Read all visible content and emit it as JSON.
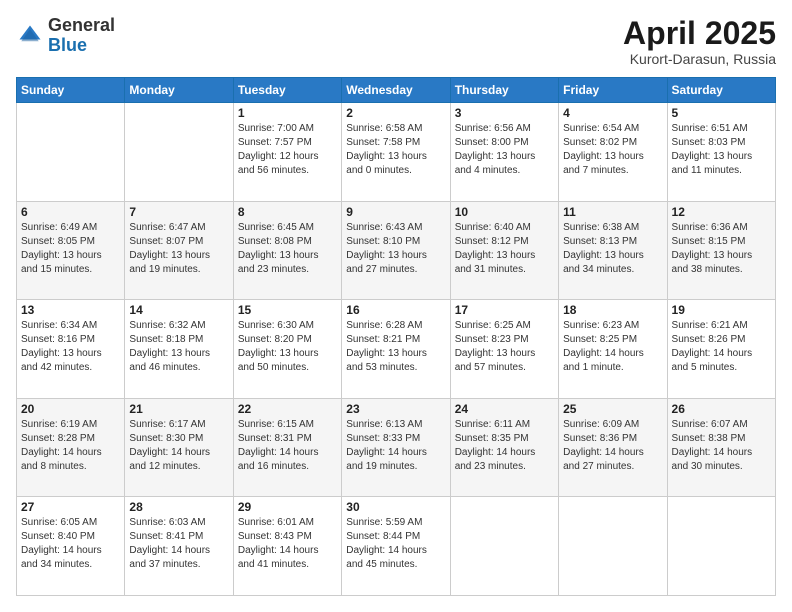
{
  "header": {
    "logo_general": "General",
    "logo_blue": "Blue",
    "month_title": "April 2025",
    "location": "Kurort-Darasun, Russia"
  },
  "weekdays": [
    "Sunday",
    "Monday",
    "Tuesday",
    "Wednesday",
    "Thursday",
    "Friday",
    "Saturday"
  ],
  "weeks": [
    [
      {
        "day": "",
        "info": ""
      },
      {
        "day": "",
        "info": ""
      },
      {
        "day": "1",
        "info": "Sunrise: 7:00 AM\nSunset: 7:57 PM\nDaylight: 12 hours\nand 56 minutes."
      },
      {
        "day": "2",
        "info": "Sunrise: 6:58 AM\nSunset: 7:58 PM\nDaylight: 13 hours\nand 0 minutes."
      },
      {
        "day": "3",
        "info": "Sunrise: 6:56 AM\nSunset: 8:00 PM\nDaylight: 13 hours\nand 4 minutes."
      },
      {
        "day": "4",
        "info": "Sunrise: 6:54 AM\nSunset: 8:02 PM\nDaylight: 13 hours\nand 7 minutes."
      },
      {
        "day": "5",
        "info": "Sunrise: 6:51 AM\nSunset: 8:03 PM\nDaylight: 13 hours\nand 11 minutes."
      }
    ],
    [
      {
        "day": "6",
        "info": "Sunrise: 6:49 AM\nSunset: 8:05 PM\nDaylight: 13 hours\nand 15 minutes."
      },
      {
        "day": "7",
        "info": "Sunrise: 6:47 AM\nSunset: 8:07 PM\nDaylight: 13 hours\nand 19 minutes."
      },
      {
        "day": "8",
        "info": "Sunrise: 6:45 AM\nSunset: 8:08 PM\nDaylight: 13 hours\nand 23 minutes."
      },
      {
        "day": "9",
        "info": "Sunrise: 6:43 AM\nSunset: 8:10 PM\nDaylight: 13 hours\nand 27 minutes."
      },
      {
        "day": "10",
        "info": "Sunrise: 6:40 AM\nSunset: 8:12 PM\nDaylight: 13 hours\nand 31 minutes."
      },
      {
        "day": "11",
        "info": "Sunrise: 6:38 AM\nSunset: 8:13 PM\nDaylight: 13 hours\nand 34 minutes."
      },
      {
        "day": "12",
        "info": "Sunrise: 6:36 AM\nSunset: 8:15 PM\nDaylight: 13 hours\nand 38 minutes."
      }
    ],
    [
      {
        "day": "13",
        "info": "Sunrise: 6:34 AM\nSunset: 8:16 PM\nDaylight: 13 hours\nand 42 minutes."
      },
      {
        "day": "14",
        "info": "Sunrise: 6:32 AM\nSunset: 8:18 PM\nDaylight: 13 hours\nand 46 minutes."
      },
      {
        "day": "15",
        "info": "Sunrise: 6:30 AM\nSunset: 8:20 PM\nDaylight: 13 hours\nand 50 minutes."
      },
      {
        "day": "16",
        "info": "Sunrise: 6:28 AM\nSunset: 8:21 PM\nDaylight: 13 hours\nand 53 minutes."
      },
      {
        "day": "17",
        "info": "Sunrise: 6:25 AM\nSunset: 8:23 PM\nDaylight: 13 hours\nand 57 minutes."
      },
      {
        "day": "18",
        "info": "Sunrise: 6:23 AM\nSunset: 8:25 PM\nDaylight: 14 hours\nand 1 minute."
      },
      {
        "day": "19",
        "info": "Sunrise: 6:21 AM\nSunset: 8:26 PM\nDaylight: 14 hours\nand 5 minutes."
      }
    ],
    [
      {
        "day": "20",
        "info": "Sunrise: 6:19 AM\nSunset: 8:28 PM\nDaylight: 14 hours\nand 8 minutes."
      },
      {
        "day": "21",
        "info": "Sunrise: 6:17 AM\nSunset: 8:30 PM\nDaylight: 14 hours\nand 12 minutes."
      },
      {
        "day": "22",
        "info": "Sunrise: 6:15 AM\nSunset: 8:31 PM\nDaylight: 14 hours\nand 16 minutes."
      },
      {
        "day": "23",
        "info": "Sunrise: 6:13 AM\nSunset: 8:33 PM\nDaylight: 14 hours\nand 19 minutes."
      },
      {
        "day": "24",
        "info": "Sunrise: 6:11 AM\nSunset: 8:35 PM\nDaylight: 14 hours\nand 23 minutes."
      },
      {
        "day": "25",
        "info": "Sunrise: 6:09 AM\nSunset: 8:36 PM\nDaylight: 14 hours\nand 27 minutes."
      },
      {
        "day": "26",
        "info": "Sunrise: 6:07 AM\nSunset: 8:38 PM\nDaylight: 14 hours\nand 30 minutes."
      }
    ],
    [
      {
        "day": "27",
        "info": "Sunrise: 6:05 AM\nSunset: 8:40 PM\nDaylight: 14 hours\nand 34 minutes."
      },
      {
        "day": "28",
        "info": "Sunrise: 6:03 AM\nSunset: 8:41 PM\nDaylight: 14 hours\nand 37 minutes."
      },
      {
        "day": "29",
        "info": "Sunrise: 6:01 AM\nSunset: 8:43 PM\nDaylight: 14 hours\nand 41 minutes."
      },
      {
        "day": "30",
        "info": "Sunrise: 5:59 AM\nSunset: 8:44 PM\nDaylight: 14 hours\nand 45 minutes."
      },
      {
        "day": "",
        "info": ""
      },
      {
        "day": "",
        "info": ""
      },
      {
        "day": "",
        "info": ""
      }
    ]
  ]
}
